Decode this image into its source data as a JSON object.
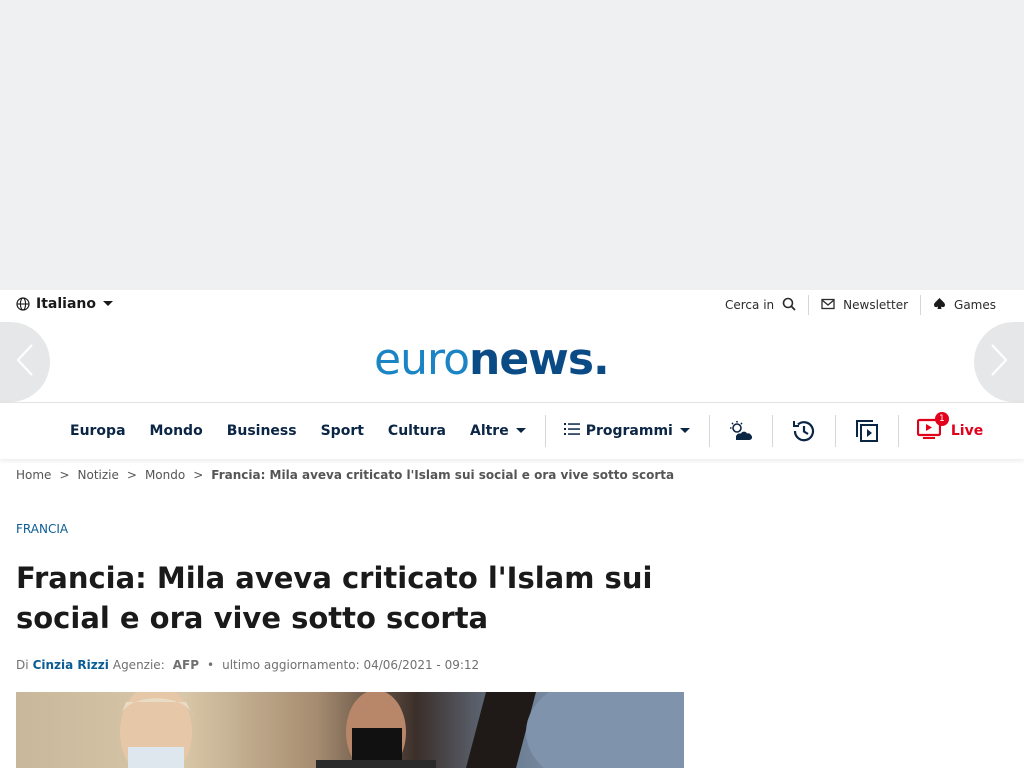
{
  "language": {
    "label": "Italiano"
  },
  "toplinks": {
    "search": "Cerca in",
    "newsletter": "Newsletter",
    "games": "Games"
  },
  "logo": {
    "thin": "euro",
    "bold": "news."
  },
  "nav": {
    "items": [
      "Europa",
      "Mondo",
      "Business",
      "Sport",
      "Cultura"
    ],
    "more": "Altre",
    "programs": "Programmi",
    "live": "Live",
    "live_badge": "1"
  },
  "breadcrumb": {
    "home": "Home",
    "news": "Notizie",
    "world": "Mondo",
    "current": "Francia: Mila aveva criticato l'Islam sui social e ora vive sotto scorta",
    "sep": ">"
  },
  "article": {
    "tag": "FRANCIA",
    "title": "Francia: Mila aveva criticato l'Islam sui social e ora vive sotto scorta",
    "by_prefix": "Di",
    "author": "Cinzia Rizzi",
    "agency_label": "Agenzie:",
    "agency": "AFP",
    "dot": "•",
    "updated": "ultimo aggiornamento: 04/06/2021 - 09:12"
  },
  "colors": {
    "brand": "#0a5c93",
    "live": "#e3001b",
    "nav_text": "#0b2545"
  }
}
